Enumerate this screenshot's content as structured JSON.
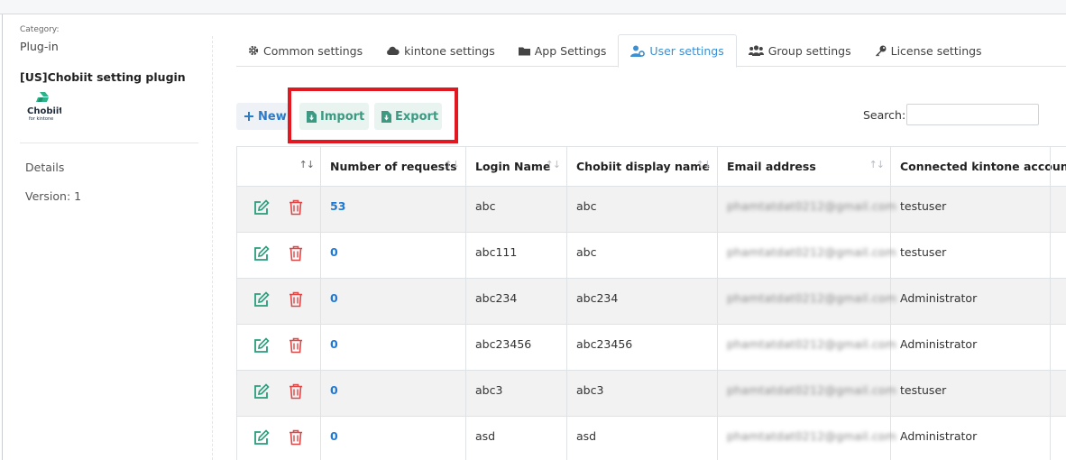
{
  "sidebar": {
    "category_label": "Category:",
    "category_value": "Plug-in",
    "plugin_name": "[US]Chobiit setting plugin",
    "logo_name": "Chobiit",
    "logo_sub": "for kintone",
    "details_label": "Details",
    "version_label": "Version: 1"
  },
  "tabs": [
    {
      "label": "Common settings",
      "icon": "gear-icon",
      "active": false
    },
    {
      "label": "kintone settings",
      "icon": "cloud-icon",
      "active": false
    },
    {
      "label": "App Settings",
      "icon": "folder-icon",
      "active": false
    },
    {
      "label": "User settings",
      "icon": "user-gear-icon",
      "active": true
    },
    {
      "label": "Group settings",
      "icon": "users-icon",
      "active": false
    },
    {
      "label": "License settings",
      "icon": "key-icon",
      "active": false
    }
  ],
  "toolbar": {
    "new_label": "New",
    "import_label": "Import",
    "export_label": "Export",
    "search_label": "Search:",
    "search_value": ""
  },
  "table": {
    "columns": [
      "",
      "Number of requests",
      "Login Name",
      "Chobiit display name",
      "Email address",
      "Connected kintone account"
    ],
    "rows": [
      {
        "requests": "53",
        "login": "abc",
        "display": "abc",
        "email": "phamtatdat0212@gmail.com",
        "kintone": "testuser"
      },
      {
        "requests": "0",
        "login": "abc111",
        "display": "abc",
        "email": "phamtatdat0212@gmail.com",
        "kintone": "testuser"
      },
      {
        "requests": "0",
        "login": "abc234",
        "display": "abc234",
        "email": "phamtatdat0212@gmail.com",
        "kintone": "Administrator"
      },
      {
        "requests": "0",
        "login": "abc23456",
        "display": "abc23456",
        "email": "phamtatdat0212@gmail.com",
        "kintone": "Administrator"
      },
      {
        "requests": "0",
        "login": "abc3",
        "display": "abc3",
        "email": "phamtatdat0212@gmail.com",
        "kintone": "testuser"
      },
      {
        "requests": "0",
        "login": "asd",
        "display": "asd",
        "email": "phamtatdat0212@gmail.com",
        "kintone": "Administrator"
      }
    ]
  },
  "colors": {
    "accent": "#3b8fd3",
    "teal": "#3c9a83",
    "highlight": "#e3171f",
    "edit_icon": "#2a9d7c",
    "delete_icon": "#e04848"
  }
}
